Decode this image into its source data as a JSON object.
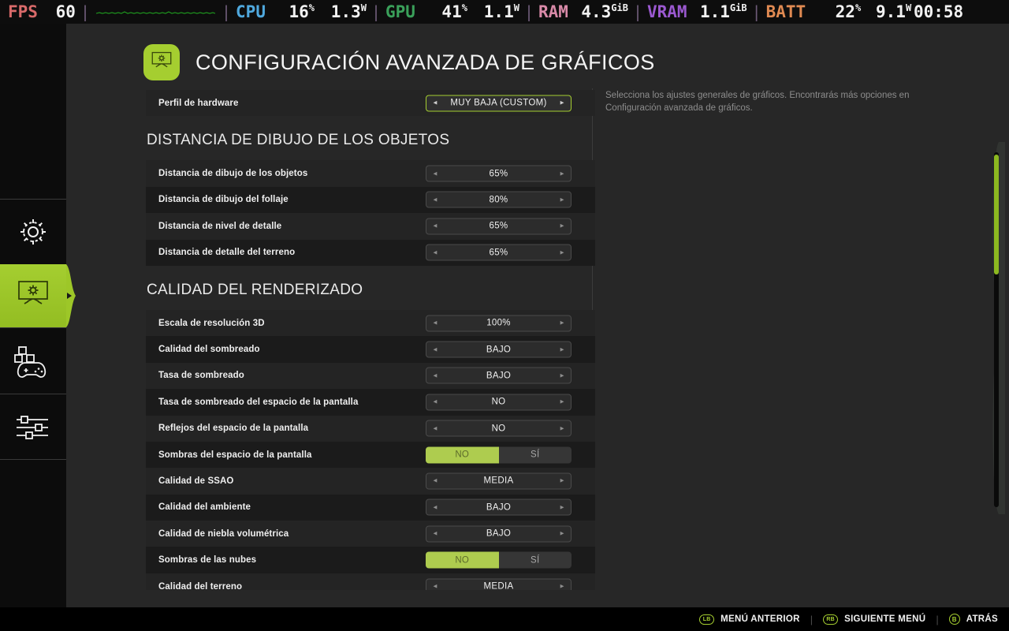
{
  "hud": {
    "fps_label": "FPS",
    "fps_value": "60",
    "graph_name": "frametime-graph",
    "cpu_label": "CPU",
    "cpu_value": "16",
    "cpu_unit": "%",
    "cpu_power": "1.3",
    "cpu_power_unit": "W",
    "gpu_label": "GPU",
    "gpu_value": "41",
    "gpu_unit": "%",
    "gpu_power": "1.1",
    "gpu_power_unit": "W",
    "ram_label": "RAM",
    "ram_value": "4.3",
    "ram_unit": "GiB",
    "vram_label": "VRAM",
    "vram_value": "1.1",
    "vram_unit": "GiB",
    "batt_label": "BATT",
    "batt_value": "22",
    "batt_unit": "%",
    "batt_power": "9.1",
    "batt_power_unit": "W",
    "clock": "00:58",
    "colors": {
      "fps": "#d96a6a",
      "cpu": "#4fa8dd",
      "gpu": "#3aa05a",
      "ram": "#d98aa8",
      "vram": "#9b59d0",
      "batt": "#e08a52",
      "graph_line": "#1f9d1f"
    }
  },
  "sidebar": {
    "items": [
      {
        "name": "general-settings",
        "icon": "gear-icon",
        "active": false
      },
      {
        "name": "graphics-settings",
        "icon": "monitor-gear-icon",
        "active": true
      },
      {
        "name": "controls-settings",
        "icon": "gamepad-icon",
        "active": false
      },
      {
        "name": "advanced-sliders",
        "icon": "sliders-icon",
        "active": false
      }
    ],
    "active_accent": "#a5ce30"
  },
  "header": {
    "icon": "monitor-gear-icon",
    "title": "CONFIGURACIÓN AVANZADA DE GRÁFICOS"
  },
  "description": "Selecciona los ajustes generales de gráficos. Encontrarás más opciones en Configuración avanzada de gráficos.",
  "profile_row": {
    "label": "Perfil de hardware",
    "value": "MUY BAJA (CUSTOM)",
    "type": "stepper",
    "focused": true,
    "left_arrow": "◄",
    "right_arrow": "►"
  },
  "sections": [
    {
      "title": "DISTANCIA DE DIBUJO DE LOS OBJETOS",
      "rows": [
        {
          "label": "Distancia de dibujo de los objetos",
          "value": "65%",
          "type": "stepper"
        },
        {
          "label": "Distancia de dibujo del follaje",
          "value": "80%",
          "type": "stepper"
        },
        {
          "label": "Distancia de nivel de detalle",
          "value": "65%",
          "type": "stepper"
        },
        {
          "label": "Distancia de detalle del terreno",
          "value": "65%",
          "type": "stepper"
        }
      ]
    },
    {
      "title": "CALIDAD DEL RENDERIZADO",
      "rows": [
        {
          "label": "Escala de resolución 3D",
          "value": "100%",
          "type": "stepper"
        },
        {
          "label": "Calidad del sombreado",
          "value": "BAJO",
          "type": "stepper"
        },
        {
          "label": "Tasa de sombreado",
          "value": "BAJO",
          "type": "stepper"
        },
        {
          "label": "Tasa de sombreado del espacio de la pantalla",
          "value": "NO",
          "type": "stepper"
        },
        {
          "label": "Reflejos del espacio de la pantalla",
          "value": "NO",
          "type": "stepper"
        },
        {
          "label": "Sombras del espacio de la pantalla",
          "type": "toggle",
          "options": [
            "NO",
            "SÍ"
          ],
          "selected": "NO"
        },
        {
          "label": "Calidad de SSAO",
          "value": "MEDIA",
          "type": "stepper"
        },
        {
          "label": "Calidad del ambiente",
          "value": "BAJO",
          "type": "stepper"
        },
        {
          "label": "Calidad de niebla volumétrica",
          "value": "BAJO",
          "type": "stepper"
        },
        {
          "label": "Sombras de las nubes",
          "type": "toggle",
          "options": [
            "NO",
            "SÍ"
          ],
          "selected": "NO"
        },
        {
          "label": "Calidad del terreno",
          "value": "MEDIA",
          "type": "stepper"
        }
      ]
    }
  ],
  "scrollbar": {
    "thumb_position_percent": 1,
    "visible_fraction_percent": 34
  },
  "footer": {
    "hints": [
      {
        "button": "LB",
        "shape": "pill",
        "label": "MENÚ ANTERIOR"
      },
      {
        "button": "RB",
        "shape": "pill",
        "label": "SIGUIENTE MENÚ"
      },
      {
        "button": "B",
        "shape": "round",
        "label": "ATRÁS"
      }
    ]
  }
}
